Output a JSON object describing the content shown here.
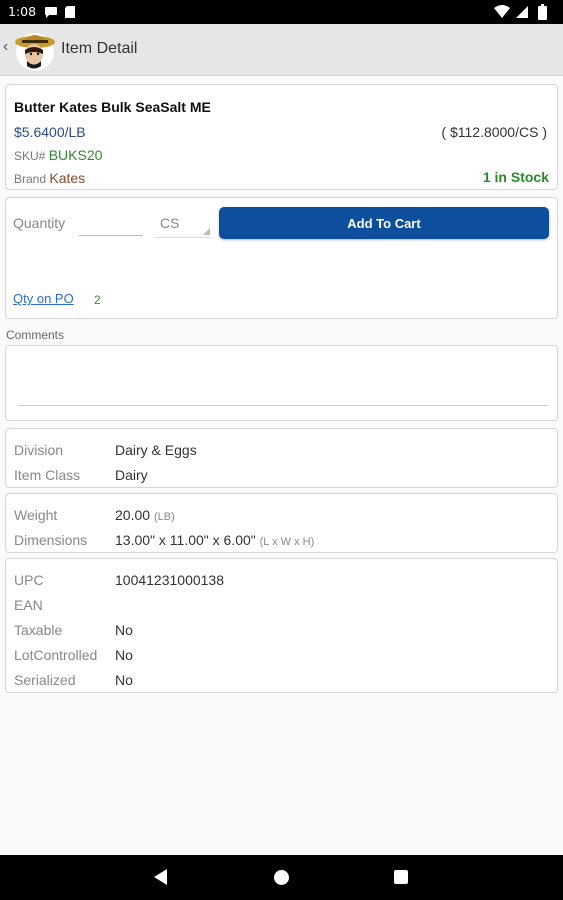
{
  "status_bar": {
    "time": "1:08"
  },
  "header": {
    "title": "Item Detail",
    "back_glyph": "‹"
  },
  "product": {
    "name": "Butter Kates Bulk SeaSalt ME",
    "unit_price": "$5.6400/LB",
    "case_price": "( $112.8000/CS )",
    "sku_label": "SKU#",
    "sku_value": "BUKS20",
    "brand_label": "Brand",
    "brand_value": "Kates",
    "stock": "1 in Stock"
  },
  "order": {
    "quantity_label": "Quantity",
    "quantity_value": "",
    "unit_value": "CS",
    "add_to_cart_label": "Add To Cart",
    "qty_on_po_label": "Qty on PO",
    "qty_on_po_value": "2"
  },
  "comments": {
    "label": "Comments",
    "value": ""
  },
  "classification": {
    "division_label": "Division",
    "division_value": "Dairy & Eggs",
    "item_class_label": "Item Class",
    "item_class_value": "Dairy"
  },
  "dimensions": {
    "weight_label": "Weight",
    "weight_value": "20.00",
    "weight_unit": "(LB)",
    "dimensions_label": "Dimensions",
    "dimensions_value": "13.00\" x 11.00\" x 6.00\"",
    "dimensions_unit": "(L x W x H)"
  },
  "attributes": {
    "upc_label": "UPC",
    "upc_value": "10041231000138",
    "ean_label": "EAN",
    "ean_value": "",
    "taxable_label": "Taxable",
    "taxable_value": "No",
    "lot_label": "LotControlled",
    "lot_value": "No",
    "serialized_label": "Serialized",
    "serialized_value": "No"
  },
  "colors": {
    "accent": "#0d4f9c",
    "price": "#2c4a8c",
    "stock": "#2a8a2a",
    "sku": "#2e8a2e",
    "brand": "#8b4a2b",
    "link": "#2a6ecf"
  },
  "icons": [
    "message-icon",
    "sim-card-icon",
    "wifi-icon",
    "cell-signal-icon",
    "battery-icon",
    "back-arrow-icon",
    "brand-logo",
    "nav-back-icon",
    "nav-home-icon",
    "nav-recents-icon"
  ]
}
